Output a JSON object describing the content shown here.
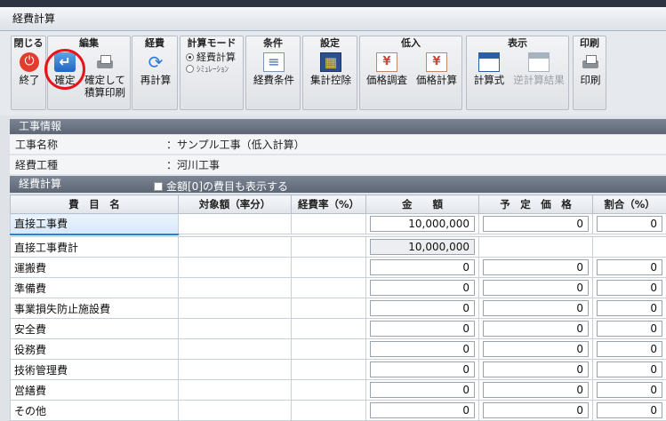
{
  "window": {
    "title": "経費計算"
  },
  "ribbon": {
    "groups": {
      "close": {
        "title": "閉じる",
        "buttons": {
          "finish": "終了"
        }
      },
      "edit": {
        "title": "編集",
        "buttons": {
          "confirm": "確定",
          "confirm_print_line1": "確定して",
          "confirm_print_line2": "積算印刷"
        }
      },
      "expense": {
        "title": "経費",
        "buttons": {
          "recalc": "再計算"
        }
      },
      "mode": {
        "title": "計算モード",
        "options": [
          "経費計算",
          "ｼﾐｭﾚｰｼｮﾝ"
        ],
        "selected": "経費計算"
      },
      "condition": {
        "title": "条件",
        "buttons": {
          "expense_condition": "経費条件"
        }
      },
      "settings": {
        "title": "設定",
        "buttons": {
          "aggregate_deduction": "集計控除"
        }
      },
      "low_bid": {
        "title": "低入",
        "buttons": {
          "price_survey": "価格調査",
          "price_calc": "価格計算"
        }
      },
      "display": {
        "title": "表示",
        "buttons": {
          "formula": "計算式",
          "reverse_result": "逆計算結果"
        }
      },
      "print": {
        "title": "印刷",
        "buttons": {
          "print": "印刷"
        }
      }
    }
  },
  "project_info": {
    "header": "工事情報",
    "rows": [
      {
        "label": "工事名称",
        "value": "：サンプル工事（低入計算）"
      },
      {
        "label": "経費工種",
        "value": "：河川工事"
      }
    ]
  },
  "expense_calc": {
    "header": "経費計算",
    "show_zero_label": "金額[0]の費目も表示する",
    "columns": [
      "費　目　名",
      "対象額（率分）",
      "経費率（%）",
      "金　　額",
      "予　定　価　格",
      "割合（%）"
    ],
    "rows": [
      {
        "name": "直接工事費",
        "amount": "10,000,000",
        "planned": "0",
        "ratio": "0"
      },
      {
        "name": "直接工事費計",
        "amount": "10,000,000"
      },
      {
        "name": "運搬費",
        "amount": "0",
        "planned": "0",
        "ratio": "0"
      },
      {
        "name": "準備費",
        "amount": "0",
        "planned": "0",
        "ratio": "0"
      },
      {
        "name": "事業損失防止施設費",
        "amount": "0",
        "planned": "0",
        "ratio": "0"
      },
      {
        "name": "安全費",
        "amount": "0",
        "planned": "0",
        "ratio": "0"
      },
      {
        "name": "役務費",
        "amount": "0",
        "planned": "0",
        "ratio": "0"
      },
      {
        "name": "技術管理費",
        "amount": "0",
        "planned": "0",
        "ratio": "0"
      },
      {
        "name": "営繕費",
        "amount": "0",
        "planned": "0",
        "ratio": "0"
      },
      {
        "name": "その他",
        "amount": "0",
        "planned": "0",
        "ratio": "0"
      }
    ]
  },
  "colors": {
    "accent": "#2f7fd6",
    "highlight_circle": "#e8131b",
    "section_header": "#5d6674"
  }
}
